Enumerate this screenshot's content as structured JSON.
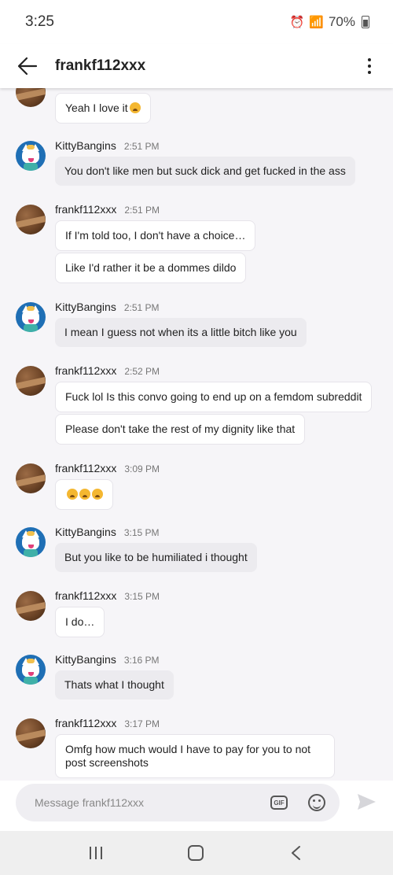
{
  "status": {
    "time": "3:25",
    "battery": "70%"
  },
  "header": {
    "title": "frankf112xxx"
  },
  "messages": [
    {
      "sender": "",
      "time": "",
      "texts": [
        "Yeah I love it"
      ]
    },
    {
      "sender": "KittyBangins",
      "time": "2:51 PM",
      "texts": [
        "You don't like men but suck dick and get fucked in the ass"
      ]
    },
    {
      "sender": "frankf112xxx",
      "time": "2:51 PM",
      "texts": [
        "If I'm told too, I don't have a choice…",
        "Like I'd rather it be a dommes dildo"
      ]
    },
    {
      "sender": "KittyBangins",
      "time": "2:51 PM",
      "texts": [
        "I mean I guess not when its a little bitch like you"
      ]
    },
    {
      "sender": "frankf112xxx",
      "time": "2:52 PM",
      "texts": [
        "Fuck lol Is this convo going to end up on a femdom subreddit",
        "Please don't take the rest of my dignity like that"
      ]
    },
    {
      "sender": "frankf112xxx",
      "time": "3:09 PM",
      "texts": [
        ""
      ]
    },
    {
      "sender": "KittyBangins",
      "time": "3:15 PM",
      "texts": [
        "But you like to be humiliated i thought"
      ]
    },
    {
      "sender": "frankf112xxx",
      "time": "3:15 PM",
      "texts": [
        "I do…"
      ]
    },
    {
      "sender": "KittyBangins",
      "time": "3:16 PM",
      "texts": [
        "Thats what I thought"
      ]
    },
    {
      "sender": "frankf112xxx",
      "time": "3:17 PM",
      "texts": [
        "Omfg how much would I have to pay for you to not post screenshots"
      ]
    }
  ],
  "composer": {
    "placeholder": "Message frankf112xxx",
    "gif_label": "GIF"
  },
  "icons": {
    "back": "arrow-left-icon",
    "more": "more-vertical-icon",
    "gif": "gif-icon",
    "emoji": "emoji-icon",
    "send": "send-icon"
  }
}
